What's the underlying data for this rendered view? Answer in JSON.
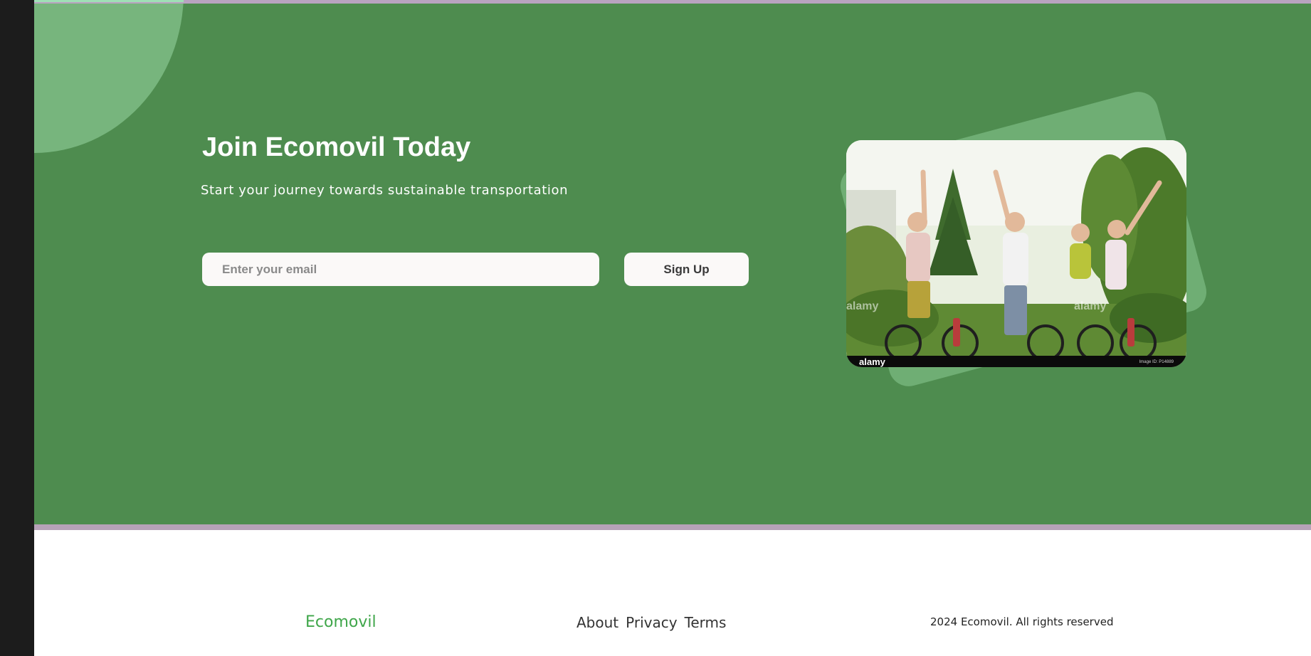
{
  "cta": {
    "title": "Join Ecomovil Today",
    "subtitle": "Start your journey towards sustainable transportation",
    "email_placeholder": "Enter your email",
    "signup_label": "Sign Up"
  },
  "photo": {
    "watermark_logo": "alamy",
    "watermark_overlay": "alamy",
    "image_id_label": "Image ID: P14889"
  },
  "footer": {
    "brand": "Ecomovil",
    "links": [
      "About",
      "Privacy",
      "Terms"
    ],
    "copyright": "2024 Ecomovil. All rights reserved"
  },
  "colors": {
    "section_green": "#4e8c4f",
    "accent_light_green": "#77b57d",
    "brand_green": "#3fa64a"
  }
}
